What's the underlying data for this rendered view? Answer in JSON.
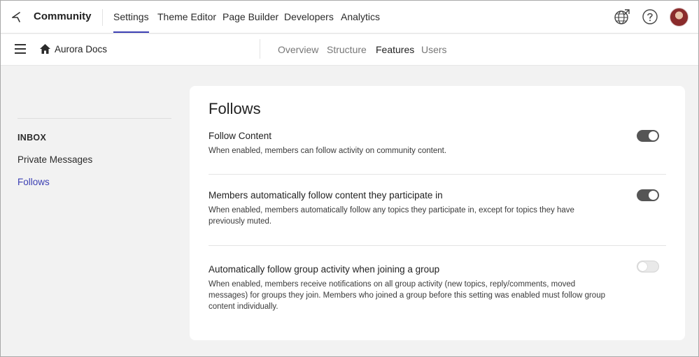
{
  "topbar": {
    "brand": "Community",
    "nav": [
      {
        "label": "Settings",
        "active": true
      },
      {
        "label": "Theme Editor",
        "active": false
      },
      {
        "label": "Page Builder",
        "active": false
      },
      {
        "label": "Developers",
        "active": false
      },
      {
        "label": "Analytics",
        "active": false
      }
    ],
    "icons": [
      "external-globe-icon",
      "help-icon",
      "user-avatar"
    ]
  },
  "subbar": {
    "breadcrumb": "Aurora Docs",
    "tabs": [
      {
        "label": "Overview",
        "active": false
      },
      {
        "label": "Structure",
        "active": false
      },
      {
        "label": "Features",
        "active": true
      },
      {
        "label": "Users",
        "active": false
      }
    ]
  },
  "sidebar": {
    "heading": "INBOX",
    "items": [
      {
        "label": "Private Messages",
        "active": false
      },
      {
        "label": "Follows",
        "active": true
      }
    ]
  },
  "card": {
    "title": "Follows",
    "settings": [
      {
        "title": "Follow Content",
        "description": "When enabled, members can follow activity on community content.",
        "enabled": true
      },
      {
        "title": "Members automatically follow content they participate in",
        "description": "When enabled, members automatically follow any topics they participate in, except for topics they have previously muted.",
        "enabled": true
      },
      {
        "title": "Automatically follow group activity when joining a group",
        "description": "When enabled, members receive notifications on all group activity (new topics, reply/comments, moved messages) for groups they join. Members who joined a group before this setting was enabled must follow group content individually.",
        "enabled": false
      }
    ]
  },
  "colors": {
    "accent": "#3b3fb3",
    "toggle_on": "#555555",
    "toggle_off": "#e9e9e9",
    "page_bg": "#f2f2f2"
  }
}
